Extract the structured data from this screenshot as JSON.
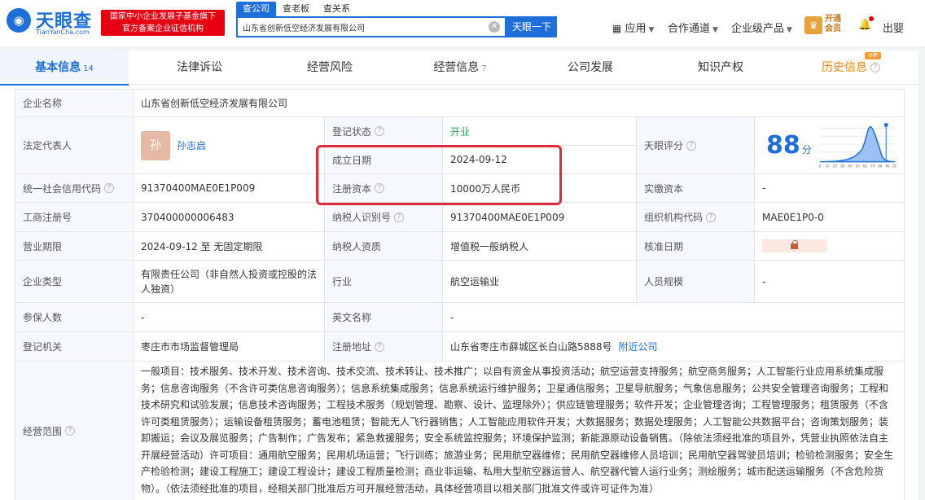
{
  "brand": {
    "name": "天眼查",
    "sub": "TianYanCha.com",
    "badge_line1": "国家中小企业发展子基金旗下",
    "badge_line2": "官方备案企业征信机构"
  },
  "search": {
    "tabs": [
      "查公司",
      "查老板",
      "查关系"
    ],
    "value": "山东省创新低空经济发展有限公司",
    "button": "天眼一下"
  },
  "topnav": {
    "apps": "应用",
    "cooperation": "合作通道",
    "enterprise": "企业级产品",
    "vip_line1": "开通",
    "vip_line2": "会员",
    "user": "出婴"
  },
  "tabs": [
    {
      "label": "基本信息",
      "count": "14"
    },
    {
      "label": "法律诉讼",
      "count": ""
    },
    {
      "label": "经营风险",
      "count": ""
    },
    {
      "label": "经营信息",
      "count": "7"
    },
    {
      "label": "公司发展",
      "count": ""
    },
    {
      "label": "知识产权",
      "count": ""
    },
    {
      "label": "历史信息",
      "count": "",
      "badge": "VIP"
    }
  ],
  "info": {
    "company_name_label": "企业名称",
    "company_name": "山东省创新低空经济发展有限公司",
    "legal_rep_label": "法定代表人",
    "legal_rep_avatar": "孙",
    "legal_rep": "孙志启",
    "reg_status_label": "登记状态",
    "reg_status": "开业",
    "est_date_label": "成立日期",
    "est_date": "2024-09-12",
    "reg_capital_label": "注册资本",
    "reg_capital": "10000万人民币",
    "score_label": "天眼评分",
    "score": "88",
    "score_unit": "分",
    "credit_code_label": "统一社会信用代码",
    "credit_code": "91370400MAE0E1P009",
    "paid_capital_label": "实缴资本",
    "paid_capital": "-",
    "biz_reg_no_label": "工商注册号",
    "biz_reg_no": "370400000006483",
    "taxpayer_id_label": "纳税人识别号",
    "taxpayer_id": "91370400MAE0E1P009",
    "org_code_label": "组织机构代码",
    "org_code": "MAE0E1P0-0",
    "biz_term_label": "营业期限",
    "biz_term": "2024-09-12 至 无固定期限",
    "taxpayer_qual_label": "纳税人资质",
    "taxpayer_qual": "增值税一般纳税人",
    "approval_date_label": "核准日期",
    "company_type_label": "企业类型",
    "company_type": "有限责任公司（非自然人投资或控股的法人独资）",
    "industry_label": "行业",
    "industry": "航空运输业",
    "staff_size_label": "人员规模",
    "staff_size": "-",
    "insured_label": "参保人数",
    "insured": "-",
    "english_name_label": "英文名称",
    "english_name": "-",
    "reg_authority_label": "登记机关",
    "reg_authority": "枣庄市市场监督管理局",
    "reg_address_label": "注册地址",
    "reg_address": "山东省枣庄市薛城区长白山路5888号",
    "nearby_link": "附近公司",
    "scope_label": "经营范围",
    "scope": "一般项目：技术服务、技术开发、技术咨询、技术交流、技术转让、技术推广；以自有资金从事投资活动；航空运营支持服务；航空商务服务；人工智能行业应用系统集成服务；信息咨询服务（不含许可类信息咨询服务）；信息系统集成服务；信息系统运行维护服务；卫星通信服务；卫星导航服务；气象信息服务；公共安全管理咨询服务；工程和技术研究和试验发展；信息技术咨询服务；工程技术服务（规划管理、勘察、设计、监理除外）；供应链管理服务；软件开发；企业管理咨询；工程管理服务；租赁服务（不含许可类租赁服务）；运输设备租赁服务；蓄电池租赁；智能无人飞行器销售；人工智能应用软件开发；大数据服务；数据处理服务；人工智能公共数据平台；咨询策划服务；装卸搬运；会议及展览服务；广告制作；广告发布；紧急救援服务；安全系统监控服务；环境保护监测；新能源原动设备销售。（除依法须经批准的项目外，凭营业执照依法自主开展经营活动）许可项目：通用航空服务；民用机场运营；飞行训练；旅游业务；民用航空器维修；民用航空器维修人员培训；民用航空器驾驶员培训；检验检测服务；安全生产检验检测；建设工程施工；建设工程设计；建设工程质量检测；商业非运输、私用大型航空器运营人、航空器代管人运行业务；测绘服务；城市配送运输服务（不含危险货物）。（依法须经批准的项目，经相关部门批准后方可开展经营活动，具体经营项目以相关部门批准文件或许可证件为准）"
  },
  "score_chart": {
    "x_ticks": [
      "0",
      "10",
      "20",
      "30",
      "40",
      "50",
      "60",
      "70",
      "80",
      "90",
      "100"
    ],
    "marker": 88
  }
}
